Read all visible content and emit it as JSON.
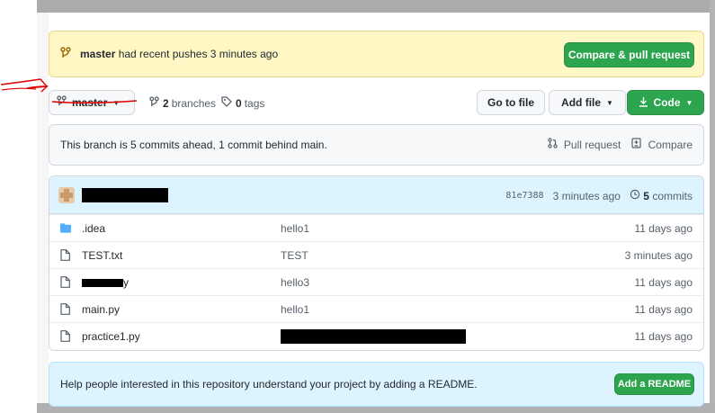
{
  "push_banner": {
    "branch": "master",
    "message": "had recent pushes 3 minutes ago",
    "compare_button": "Compare & pull request"
  },
  "branch_bar": {
    "current_branch": "master",
    "branches_count": "2",
    "branches_label": "branches",
    "tags_count": "0",
    "tags_label": "tags",
    "go_to_file": "Go to file",
    "add_file": "Add file",
    "code": "Code"
  },
  "ahead_bar": {
    "message": "This branch is 5 commits ahead, 1 commit behind main.",
    "pull_request": "Pull request",
    "compare": "Compare"
  },
  "latest_commit": {
    "sha": "81e7388",
    "time": "3 minutes ago",
    "commits_count": "5",
    "commits_label": "commits"
  },
  "files": [
    {
      "type": "folder",
      "name": ".idea",
      "message": "hello1",
      "age": "11 days ago"
    },
    {
      "type": "file",
      "name": "TEST.txt",
      "message": "TEST",
      "age": "3 minutes ago"
    },
    {
      "type": "file",
      "name": "y",
      "message": "hello3",
      "age": "11 days ago"
    },
    {
      "type": "file",
      "name": "main.py",
      "message": "hello1",
      "age": "11 days ago"
    },
    {
      "type": "file",
      "name": "practice1.py",
      "message": "",
      "age": "11 days ago"
    }
  ],
  "readme_bar": {
    "message": "Help people interested in this repository understand your project by adding a README.",
    "button": "Add a README"
  },
  "colors": {
    "accent_green": "#2da44e",
    "banner_yellow": "#fff8c5",
    "info_blue": "#ddf4ff",
    "annotation_red": "#e00000"
  }
}
